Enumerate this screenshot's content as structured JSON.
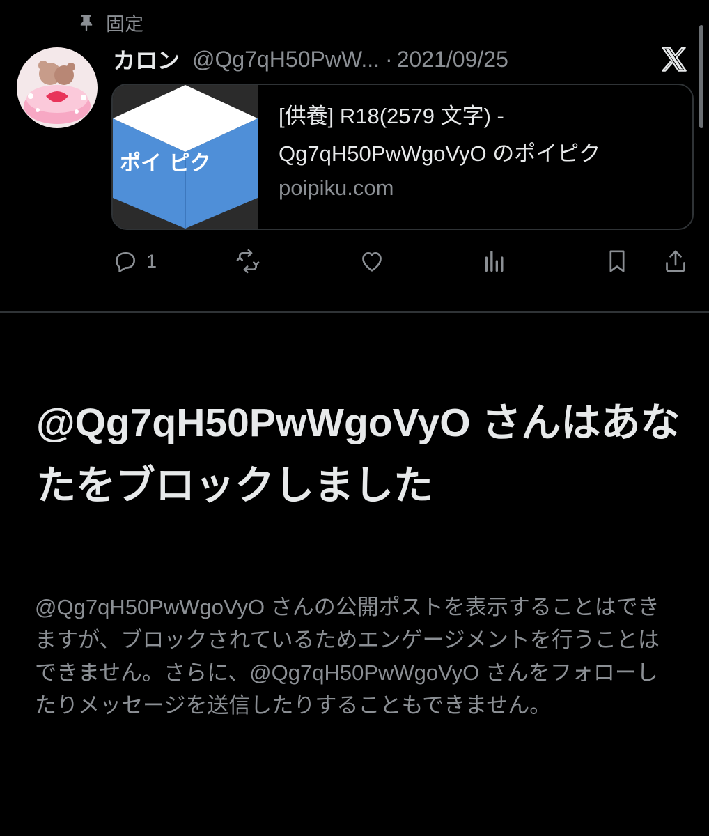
{
  "pinned": {
    "label": "固定",
    "icon": "pin-icon"
  },
  "tweet": {
    "display_name": "カロン",
    "handle": "@Qg7qH50PwW...",
    "separator": "·",
    "date": "2021/09/25",
    "card": {
      "thumb_text": "ポイ ピク",
      "title_line1": "[供養] R18(2579 文字) -",
      "title_line2": "Qg7qH50PwWgoVyO のポイピク",
      "domain": "poipiku.com"
    },
    "actions": {
      "reply_count": "1",
      "retweet_count": "",
      "like_count": ""
    }
  },
  "blocked": {
    "title": "@Qg7qH50PwWgoVyO さんはあなたをブロックしました",
    "description": "@Qg7qH50PwWgoVyO さんの公開ポストを表示することはできますが、ブロックされているためエンゲージメントを行うことはできません。さらに、@Qg7qH50PwWgoVyO さんをフォローしたりメッセージを送信したりすることもできません。"
  },
  "colors": {
    "background": "#000000",
    "text": "#e7e9ea",
    "muted": "#8b8f94",
    "border": "#2f3336",
    "poipiku_blue": "#4f8fd8"
  }
}
